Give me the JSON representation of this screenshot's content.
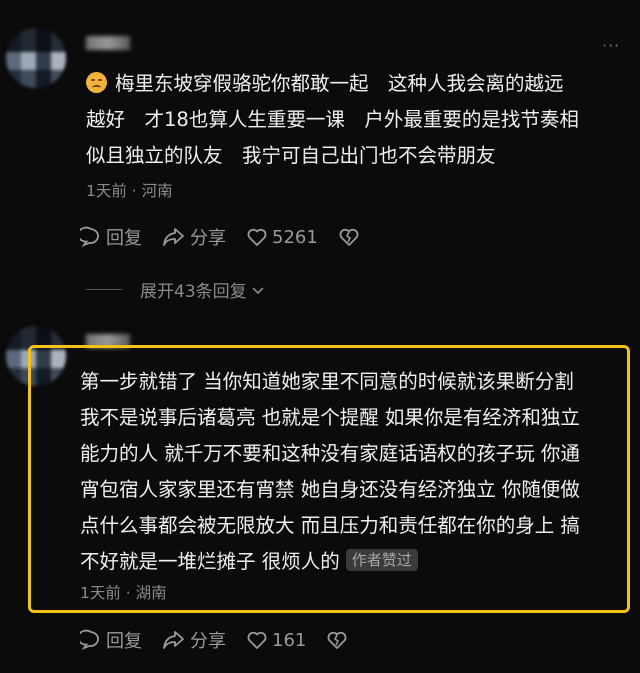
{
  "comments": [
    {
      "lines": [
        "梅里东坡穿假骆驼你都敢一起　这种人我会离的越远",
        "越好　才18也算人生重要一课　户外最重要的是找节奏相",
        "似且独立的队友　我宁可自己出门也不会带朋友"
      ],
      "meta": "1天前 · 河南",
      "reply_label": "回复",
      "share_label": "分享",
      "likes": "5261",
      "expand_label": "展开43条回复"
    },
    {
      "lines": [
        "第一步就错了 当你知道她家里不同意的时候就该果断分割",
        "我不是说事后诸葛亮 也就是个提醒 如果你是有经济和独立",
        "能力的人 就千万不要和这种没有家庭话语权的孩子玩 你通",
        "宵包宿人家家里还有宵禁 她自身还没有经济独立 你随便做",
        "点什么事都会被无限放大 而且压力和责任都在你的身上 搞",
        "不好就是一堆烂摊子 很烦人的"
      ],
      "badge": "作者赞过",
      "meta": "1天前 · 湖南",
      "reply_label": "回复",
      "share_label": "分享",
      "likes": "161"
    }
  ],
  "colors": {
    "highlight": "#f2c21a",
    "background": "#0b0b0b"
  },
  "icons": [
    "more-icon",
    "reply-icon",
    "share-icon",
    "like-icon",
    "dislike-icon",
    "chevron-down-icon"
  ]
}
